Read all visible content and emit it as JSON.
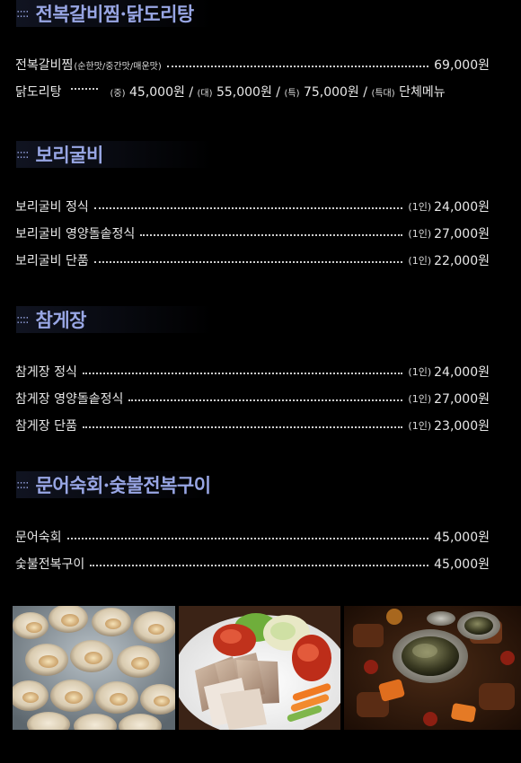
{
  "sections": [
    {
      "dots": "::::",
      "title": "전복갈비찜·닭도리탕",
      "items": [
        {
          "name": "전복갈비찜",
          "options": "(순한맛/중간맛/매운맛)",
          "price": "69,000원"
        }
      ],
      "dakdori": {
        "name": "닭도리탕",
        "s1": "(중)",
        "p1": "45,000원 /",
        "s2": "(대)",
        "p2": "55,000원 /",
        "s3": "(특)",
        "p3": "75,000원 /",
        "s4": "(특대)",
        "p4": "단체메뉴"
      }
    },
    {
      "dots": "::::",
      "title": "보리굴비",
      "items": [
        {
          "name": "보리굴비 정식",
          "size": "(1인)",
          "price": "24,000원"
        },
        {
          "name": "보리굴비 영양돌솥정식",
          "size": "(1인)",
          "price": "27,000원"
        },
        {
          "name": "보리굴비 단품",
          "size": "(1인)",
          "price": "22,000원"
        }
      ]
    },
    {
      "dots": "::::",
      "title": "참게장",
      "items": [
        {
          "name": "참게장 정식",
          "size": "(1인)",
          "price": "24,000원"
        },
        {
          "name": "참게장 영양돌솥정식",
          "size": "(1인)",
          "price": "27,000원"
        },
        {
          "name": "참게장 단품",
          "size": "(1인)",
          "price": "23,000원"
        }
      ]
    },
    {
      "dots": "::::",
      "title": "문어숙회·숯불전복구이",
      "items": [
        {
          "name": "문어숙회",
          "price": "45,000원"
        },
        {
          "name": "숯불전복구이",
          "price": "45,000원"
        }
      ]
    }
  ],
  "photos": [
    {
      "icon": "steamed-shellfish-photo"
    },
    {
      "icon": "bossam-pork-platter-photo"
    },
    {
      "icon": "braised-abalone-galbi-photo"
    }
  ]
}
